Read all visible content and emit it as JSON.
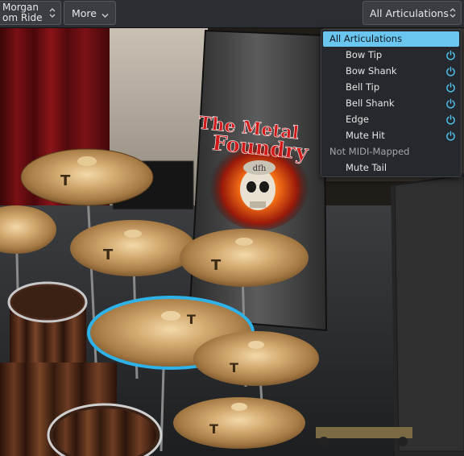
{
  "toolbar": {
    "instrument_line1": "Morgan",
    "instrument_line2": "om Ride",
    "more_label": "More",
    "articulation_selected": "All Articulations"
  },
  "articulation_menu": {
    "selected": "All Articulations",
    "mapped": [
      "Bow Tip",
      "Bow Shank",
      "Bell Tip",
      "Bell Shank",
      "Edge",
      "Mute Hit"
    ],
    "not_mapped_header": "Not MIDI-Mapped",
    "unmapped": [
      "Mute Tail"
    ],
    "accent_color": "#6bc6ef",
    "power_icon_color": "#4fbfe8"
  },
  "scene": {
    "banner_line1": "The Metal",
    "banner_line2": "Foundry",
    "emblem_text": "dfh",
    "highlight_color": "#2fb2e8"
  }
}
